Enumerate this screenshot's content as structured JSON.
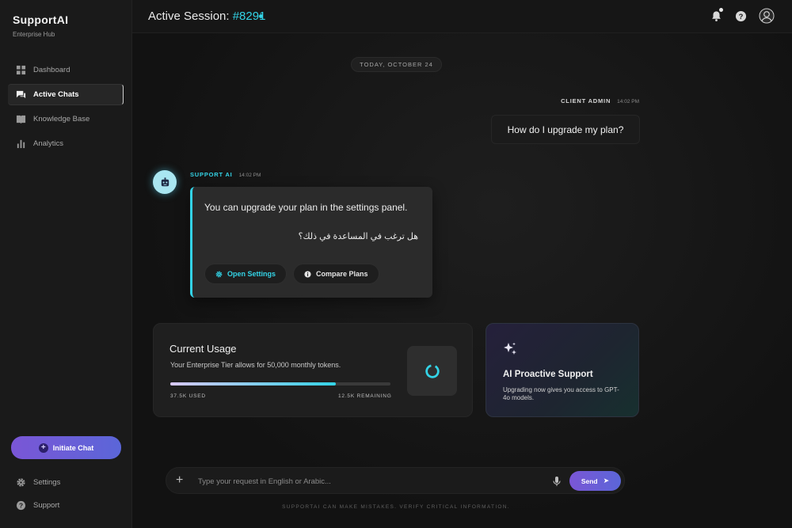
{
  "brand": {
    "title": "SupportAI",
    "subtitle": "Enterprise Hub"
  },
  "sidebar": {
    "items": [
      {
        "label": "Dashboard",
        "icon": "grid-icon",
        "active": false
      },
      {
        "label": "Active Chats",
        "icon": "chat-icon",
        "active": true
      },
      {
        "label": "Knowledge Base",
        "icon": "book-icon",
        "active": false
      },
      {
        "label": "Analytics",
        "icon": "bar-chart-icon",
        "active": false
      }
    ],
    "primary_button": "Initiate Chat",
    "bottom_items": [
      {
        "label": "Settings",
        "icon": "gear-icon"
      },
      {
        "label": "Support",
        "icon": "help-icon"
      }
    ]
  },
  "header": {
    "title_prefix": "Active Session: ",
    "session_number": "#8291",
    "icons": [
      "bell-icon",
      "help-icon",
      "user-avatar-icon"
    ]
  },
  "chat": {
    "date_divider": "TODAY, OCTOBER 24",
    "messages": [
      {
        "sender": "CLIENT ADMIN",
        "time": "14:02 PM",
        "text": "How do I upgrade my plan?"
      },
      {
        "sender": "SUPPORT AI",
        "time": "14:02 PM",
        "text": "You can upgrade your plan in the settings panel.",
        "text_ar": "هل ترغب في المساعدة في ذلك؟",
        "actions": [
          {
            "label": "Open Settings",
            "icon": "gear-icon"
          },
          {
            "label": "Compare Plans",
            "icon": "info-icon"
          }
        ]
      }
    ]
  },
  "usage": {
    "title": "Current Usage",
    "description": "Your Enterprise Tier allows for 50,000 monthly tokens.",
    "used_label": "37.5K USED",
    "remaining_label": "12.5K REMAINING",
    "progress_fraction": 0.75
  },
  "proactive": {
    "title": "AI Proactive Support",
    "description": "Upgrading now gives you access to GPT-4o models."
  },
  "composer": {
    "placeholder": "Type your request in English or Arabic...",
    "send_label": "Send"
  },
  "disclaimer": "SUPPORTAI CAN MAKE MISTAKES. VERIFY CRITICAL INFORMATION.",
  "colors": {
    "accent_cyan": "#33d3e6",
    "accent_purple": "#7a56d6",
    "background": "#151515"
  }
}
